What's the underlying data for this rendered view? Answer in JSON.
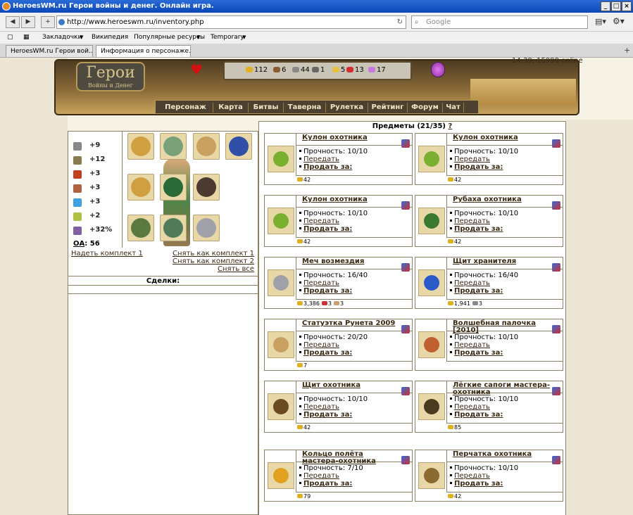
{
  "window": {
    "title": "HeroesWM.ru Герои войны и денег. Онлайн игра."
  },
  "browser": {
    "url": "http://www.heroeswm.ru/inventory.php",
    "search_placeholder": "Google",
    "bookmarks": [
      "Закладочки",
      "Википедия",
      "Популярные ресурсы",
      "Temporary"
    ],
    "tabs": [
      "HeroesWM.ru Герои вой...",
      "Информация о персонаже."
    ]
  },
  "header": {
    "logo_title": "Герои",
    "logo_subtitle": "Войны и Денег",
    "time_online": "14:39, 15998 online",
    "resources": [
      {
        "value": "112",
        "color": "#e0b020"
      },
      {
        "value": "6",
        "color": "#8a5a30"
      },
      {
        "value": "44",
        "color": "#888888"
      },
      {
        "value": "1",
        "color": "#666666"
      },
      {
        "value": "5",
        "color": "#e8c040"
      },
      {
        "value": "13",
        "color": "#d03030"
      },
      {
        "value": "17",
        "color": "#c878e0"
      }
    ],
    "menu": [
      "Персонаж",
      "Карта",
      "Битвы",
      "Таверна",
      "Рулетка",
      "Рейтинг",
      "Форум",
      "Чат"
    ]
  },
  "stats": [
    {
      "icon": "sword-icon",
      "value": "+9",
      "color": "#888888"
    },
    {
      "icon": "shield-icon",
      "value": "+12",
      "color": "#8a7a50"
    },
    {
      "icon": "wand-icon",
      "value": "+3",
      "color": "#c04020"
    },
    {
      "icon": "book-icon",
      "value": "+3",
      "color": "#b06040"
    },
    {
      "icon": "rainbow-icon",
      "value": "+3",
      "color": "#40a0e0"
    },
    {
      "icon": "bow-icon",
      "value": "+2",
      "color": "#b0c040"
    },
    {
      "icon": "potion-icon",
      "value": "+32%",
      "color": "#8060a0"
    }
  ],
  "oa": {
    "label": "ОА",
    "value": "56"
  },
  "equipment_actions": {
    "wear_set": "Надеть комплект 1",
    "remove_set1": "Снять как комплект 1",
    "remove_set2": "Снять как комплект 2",
    "remove_all": "Снять все"
  },
  "deals": {
    "label": "Сделки:"
  },
  "items_header": {
    "title": "Предметы (21/35)",
    "help": "?"
  },
  "labels": {
    "durability": "Прочность:",
    "transfer": "Передать",
    "sell": "Продать за:"
  },
  "items": [
    {
      "name": "Кулон охотника",
      "durability": "10/10",
      "price": [
        {
          "v": "42",
          "c": "#e0b020"
        }
      ],
      "icon_color": "#7ab030"
    },
    {
      "name": "Кулон охотника",
      "durability": "10/10",
      "price": [
        {
          "v": "42",
          "c": "#e0b020"
        }
      ],
      "icon_color": "#7ab030"
    },
    {
      "name": "Кулон охотника",
      "durability": "10/10",
      "price": [
        {
          "v": "42",
          "c": "#e0b020"
        }
      ],
      "icon_color": "#7ab030"
    },
    {
      "name": "Рубаха охотника",
      "durability": "10/10",
      "price": [
        {
          "v": "42",
          "c": "#e0b020"
        }
      ],
      "icon_color": "#3a7a30"
    },
    {
      "name": "Меч возмездия",
      "durability": "16/40",
      "price": [
        {
          "v": "3,386",
          "c": "#e0b020"
        },
        {
          "v": "3",
          "c": "#d03030"
        },
        {
          "v": "3",
          "c": "#c8a070"
        }
      ],
      "icon_color": "#a0a0a8"
    },
    {
      "name": "Щит хранителя",
      "durability": "16/40",
      "price": [
        {
          "v": "1,941",
          "c": "#e0b020"
        },
        {
          "v": "3",
          "c": "#888888"
        }
      ],
      "icon_color": "#2a5ac8"
    },
    {
      "name": "Статуэтка Рунета 2009",
      "durability": "20/20",
      "price": [
        {
          "v": "7",
          "c": "#e0b020"
        }
      ],
      "icon_color": "#c8a060"
    },
    {
      "name": "Волшебная палочка [2010]",
      "durability": "10/10",
      "price": [],
      "icon_color": "#c06030"
    },
    {
      "name": "Щит охотника",
      "durability": "10/10",
      "price": [
        {
          "v": "42",
          "c": "#e0b020"
        }
      ],
      "icon_color": "#6a4a20"
    },
    {
      "name": "Лёгкие сапоги мастера-охотника",
      "durability": "10/10",
      "price": [
        {
          "v": "85",
          "c": "#e0b020"
        }
      ],
      "icon_color": "#4a3a20"
    },
    {
      "name": "Кольцо полёта мастера-охотника",
      "durability": "7/10",
      "price": [
        {
          "v": "79",
          "c": "#e0b020"
        }
      ],
      "icon_color": "#e0a020"
    },
    {
      "name": "Перчатка охотника",
      "durability": "10/10",
      "price": [
        {
          "v": "42",
          "c": "#e0b020"
        }
      ],
      "icon_color": "#8a6a30"
    }
  ]
}
